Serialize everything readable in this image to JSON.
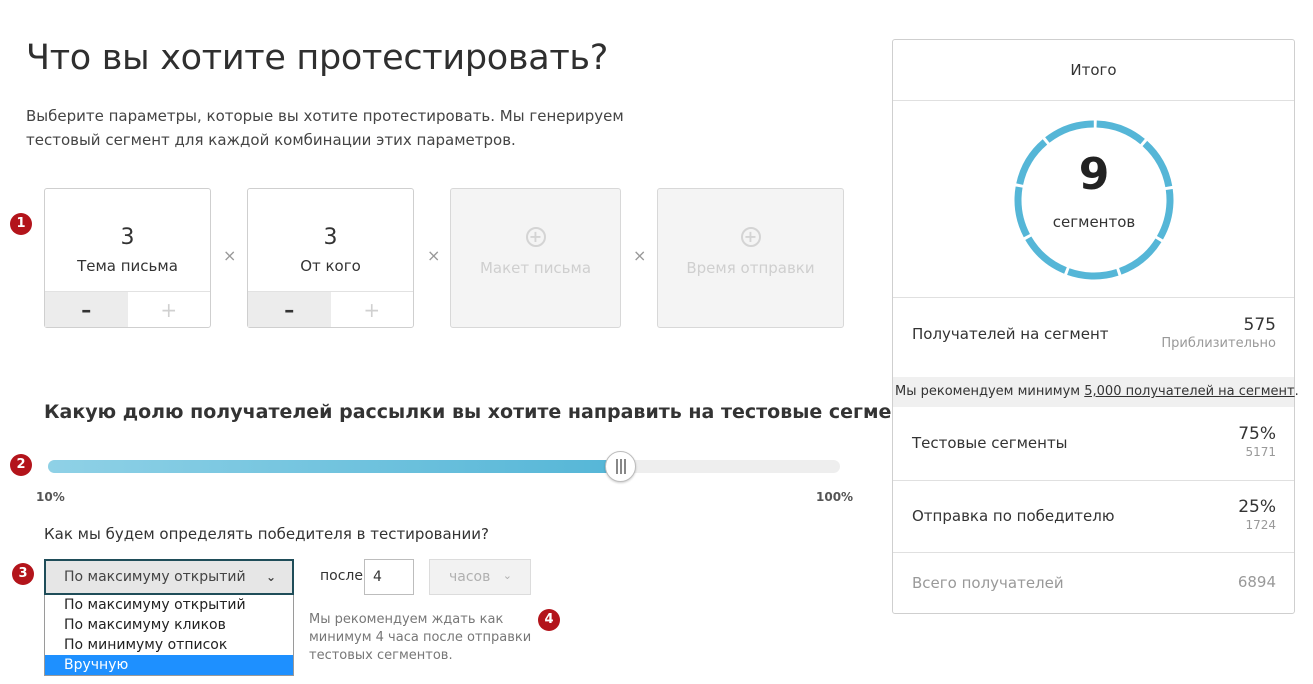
{
  "page": {
    "title": "Что вы хотите протестировать?",
    "intro_line1": "Выберите параметры, которые вы хотите протестировать. Мы генерируем",
    "intro_line2": "тестовый сегмент для каждой комбинации этих параметров."
  },
  "steps": [
    "1",
    "2",
    "3",
    "4"
  ],
  "parameters": [
    {
      "count": "3",
      "label": "Тема письма",
      "minus": "–",
      "plus": "+"
    },
    {
      "count": "3",
      "label": "От кого",
      "minus": "–",
      "plus": "+"
    },
    {
      "label": "Макет письма",
      "icon": "plus-circle-icon"
    },
    {
      "label": "Время отправки",
      "icon": "plus-circle-icon"
    }
  ],
  "times_sign": "×",
  "split": {
    "question": "Какую долю получателей рассылки вы хотите направить на тестовые сегменты?",
    "min_label": "10%",
    "max_label": "100%",
    "value_percent": 75
  },
  "winner": {
    "question": "Как мы будем определять победителя в тестировании?",
    "selected": "По максимуму открытий",
    "options": [
      "По максимуму открытий",
      "По максимуму кликов",
      "По минимуму отписок",
      "Вручную"
    ],
    "highlighted_option": "Вручную",
    "after_label": "после",
    "hours_value": "4",
    "unit": "часов",
    "hint_line1": "Мы рекомендуем ждать как",
    "hint_line2": "минимум 4 часа после отправки",
    "hint_line3": "тестовых сегментов."
  },
  "summary": {
    "title": "Итого",
    "segments_count": "9",
    "segments_label": "сегментов",
    "recipients_label": "Получателей на сегмент",
    "recipients_value": "575",
    "recipients_sub": "Приблизительно",
    "recommend_prefix": "Мы рекомендуем минимум ",
    "recommend_link": "5,000 получателей на сегмент",
    "recommend_suffix": ".",
    "test_label": "Тестовые сегменты",
    "test_value": "75%",
    "test_sub": "5171",
    "winner_label": "Отправка по победителю",
    "winner_value": "25%",
    "winner_sub": "1724",
    "total_label": "Всего получателей",
    "total_value": "6894"
  },
  "colors": {
    "accent": "#55b6d7",
    "step_badge": "#b3141b",
    "dropdown_highlight": "#1e90ff"
  }
}
